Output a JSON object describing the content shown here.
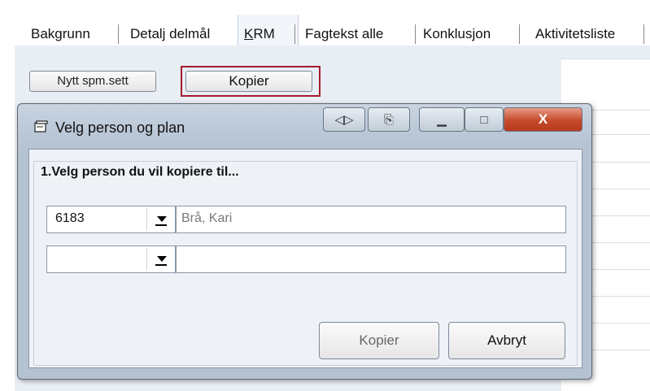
{
  "tabs": [
    {
      "label": "Bakgrunn"
    },
    {
      "label": "Detalj delmål"
    },
    {
      "label_prefix": "",
      "label_key": "K",
      "label_rest": "RM"
    },
    {
      "label": "Fagtekst alle"
    },
    {
      "label": "Konklusjon"
    },
    {
      "label": "Aktivitetsliste"
    }
  ],
  "toolbar": {
    "nytt_label": "Nytt spm.sett",
    "kopier_label": "Kopier"
  },
  "dialog": {
    "title": "Velg person og plan",
    "title_icon": "window-app-icon",
    "caption_buttons": {
      "extra1": "◁▷",
      "extra2": "⎘",
      "minimize": "▁",
      "maximize": "□",
      "close": "X"
    },
    "step_label": "1.Velg person du vil kopiere til...",
    "rows": [
      {
        "combo_value": "6183",
        "name_value": "Brå, Kari"
      },
      {
        "combo_value": "",
        "name_value": ""
      }
    ],
    "kopier_label": "Kopier",
    "avbryt_label": "Avbryt"
  },
  "colors": {
    "highlight": "#a31b2e",
    "close_button": "#c54a2c",
    "panel_bg": "#e9eef5"
  }
}
